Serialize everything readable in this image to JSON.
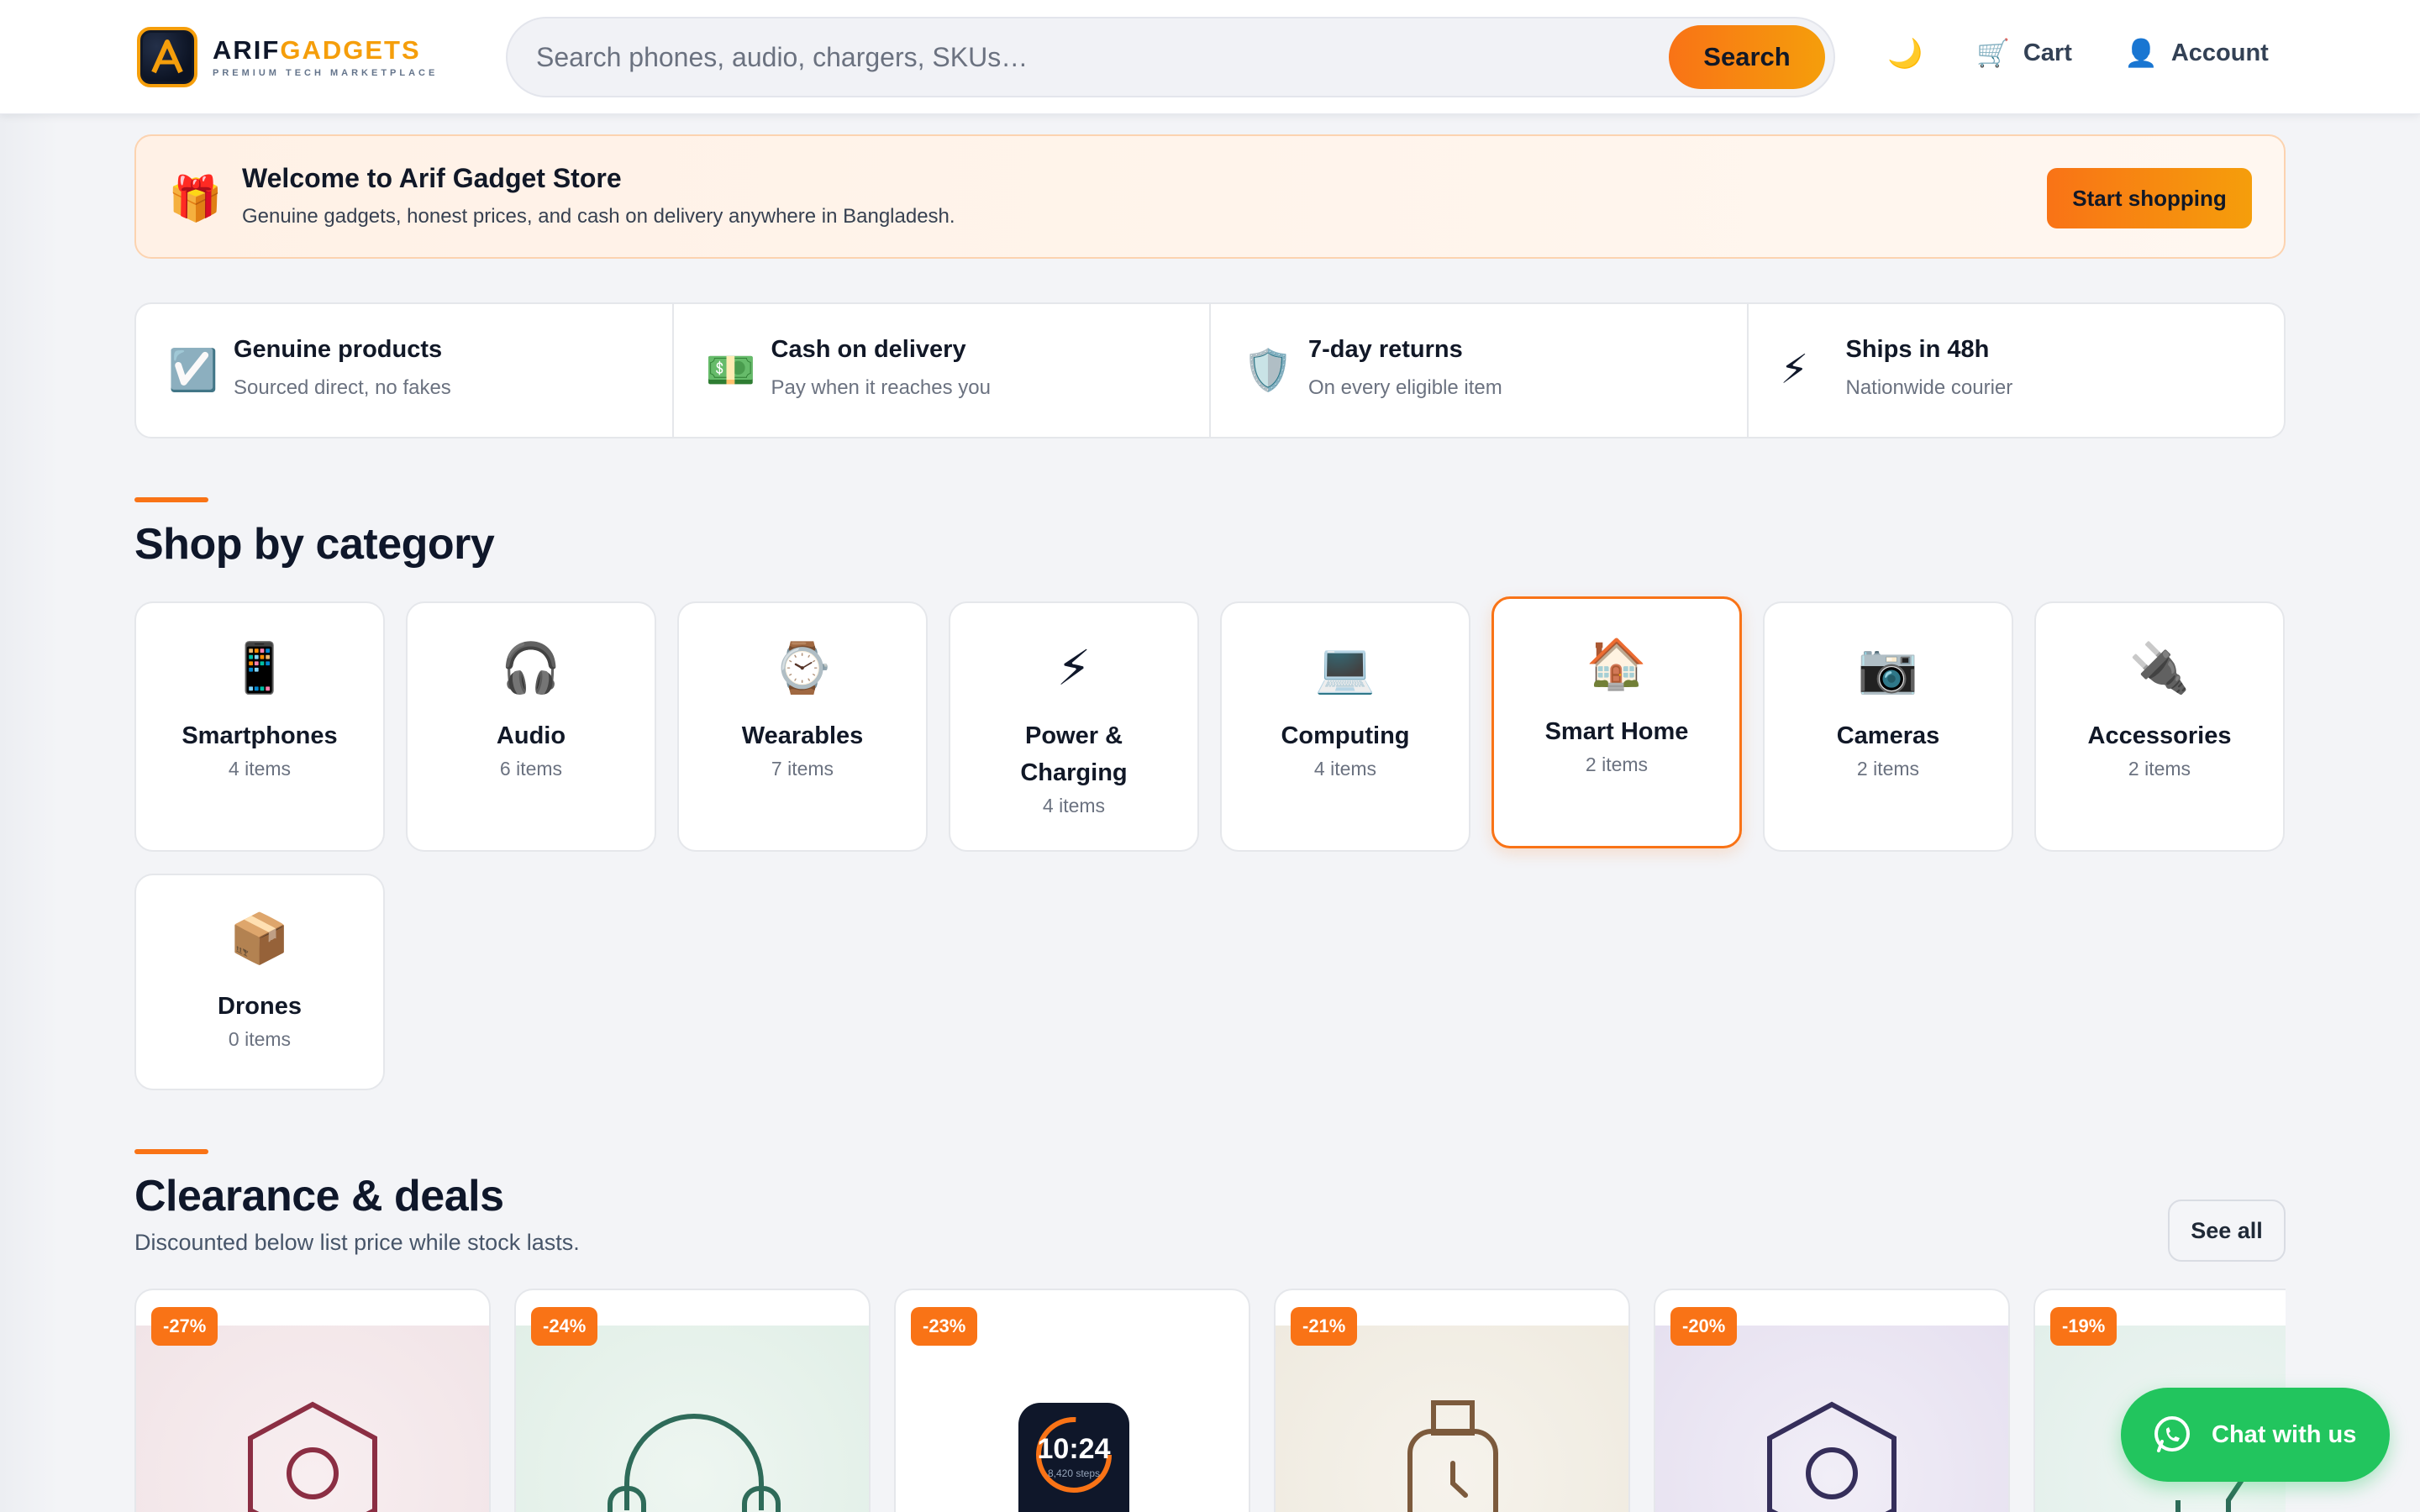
{
  "header": {
    "brand_part1": "ARIF",
    "brand_part2": "GADGETS",
    "tagline": "PREMIUM TECH MARKETPLACE",
    "search_placeholder": "Search phones, audio, chargers, SKUs…",
    "search_button": "Search",
    "theme_icon": "🌙",
    "cart_icon": "🛒",
    "cart_label": "Cart",
    "account_icon": "👤",
    "account_label": "Account",
    "accent_color": "#f97316"
  },
  "welcome": {
    "icon": "🎁",
    "title": "Welcome to Arif Gadget Store",
    "subtitle": "Genuine gadgets, honest prices, and cash on delivery anywhere in Bangladesh.",
    "button": "Start shopping"
  },
  "trust": [
    {
      "icon": "☑️",
      "title": "Genuine products",
      "subtitle": "Sourced direct, no fakes"
    },
    {
      "icon": "💵",
      "title": "Cash on delivery",
      "subtitle": "Pay when it reaches you"
    },
    {
      "icon": "🛡️",
      "title": "7-day returns",
      "subtitle": "On every eligible item"
    },
    {
      "icon": "⚡",
      "title": "Ships in 48h",
      "subtitle": "Nationwide courier"
    }
  ],
  "categories_section": {
    "title": "Shop by category",
    "items": [
      {
        "icon": "📱",
        "name": "Smartphones",
        "count": "4 items"
      },
      {
        "icon": "🎧",
        "name": "Audio",
        "count": "6 items"
      },
      {
        "icon": "⌚",
        "name": "Wearables",
        "count": "7 items"
      },
      {
        "icon": "⚡",
        "name": "Power & Charging",
        "count": "4 items"
      },
      {
        "icon": "💻",
        "name": "Computing",
        "count": "4 items"
      },
      {
        "icon": "🏠",
        "name": "Smart Home",
        "count": "2 items"
      },
      {
        "icon": "📷",
        "name": "Cameras",
        "count": "2 items"
      },
      {
        "icon": "🔌",
        "name": "Accessories",
        "count": "2 items"
      },
      {
        "icon": "📦",
        "name": "Drones",
        "count": "0 items"
      }
    ]
  },
  "deals_section": {
    "title": "Clearance & deals",
    "subtitle": "Discounted below list price while stock lasts.",
    "see_all": "See all",
    "items": [
      {
        "discount": "-27%",
        "image_icon": "smart-home-hub-icon"
      },
      {
        "discount": "-24%",
        "image_icon": "headphones-icon"
      },
      {
        "discount": "-23%",
        "image_icon": "smartwatch-icon",
        "watch_time": "10:24",
        "watch_steps": "8,420 steps"
      },
      {
        "discount": "-21%",
        "image_icon": "watch-icon"
      },
      {
        "discount": "-20%",
        "image_icon": "smart-home-hub-icon"
      },
      {
        "discount": "-19%",
        "image_icon": "cable-icon"
      }
    ]
  },
  "chat": {
    "label": "Chat with us",
    "color": "#22c55e"
  }
}
